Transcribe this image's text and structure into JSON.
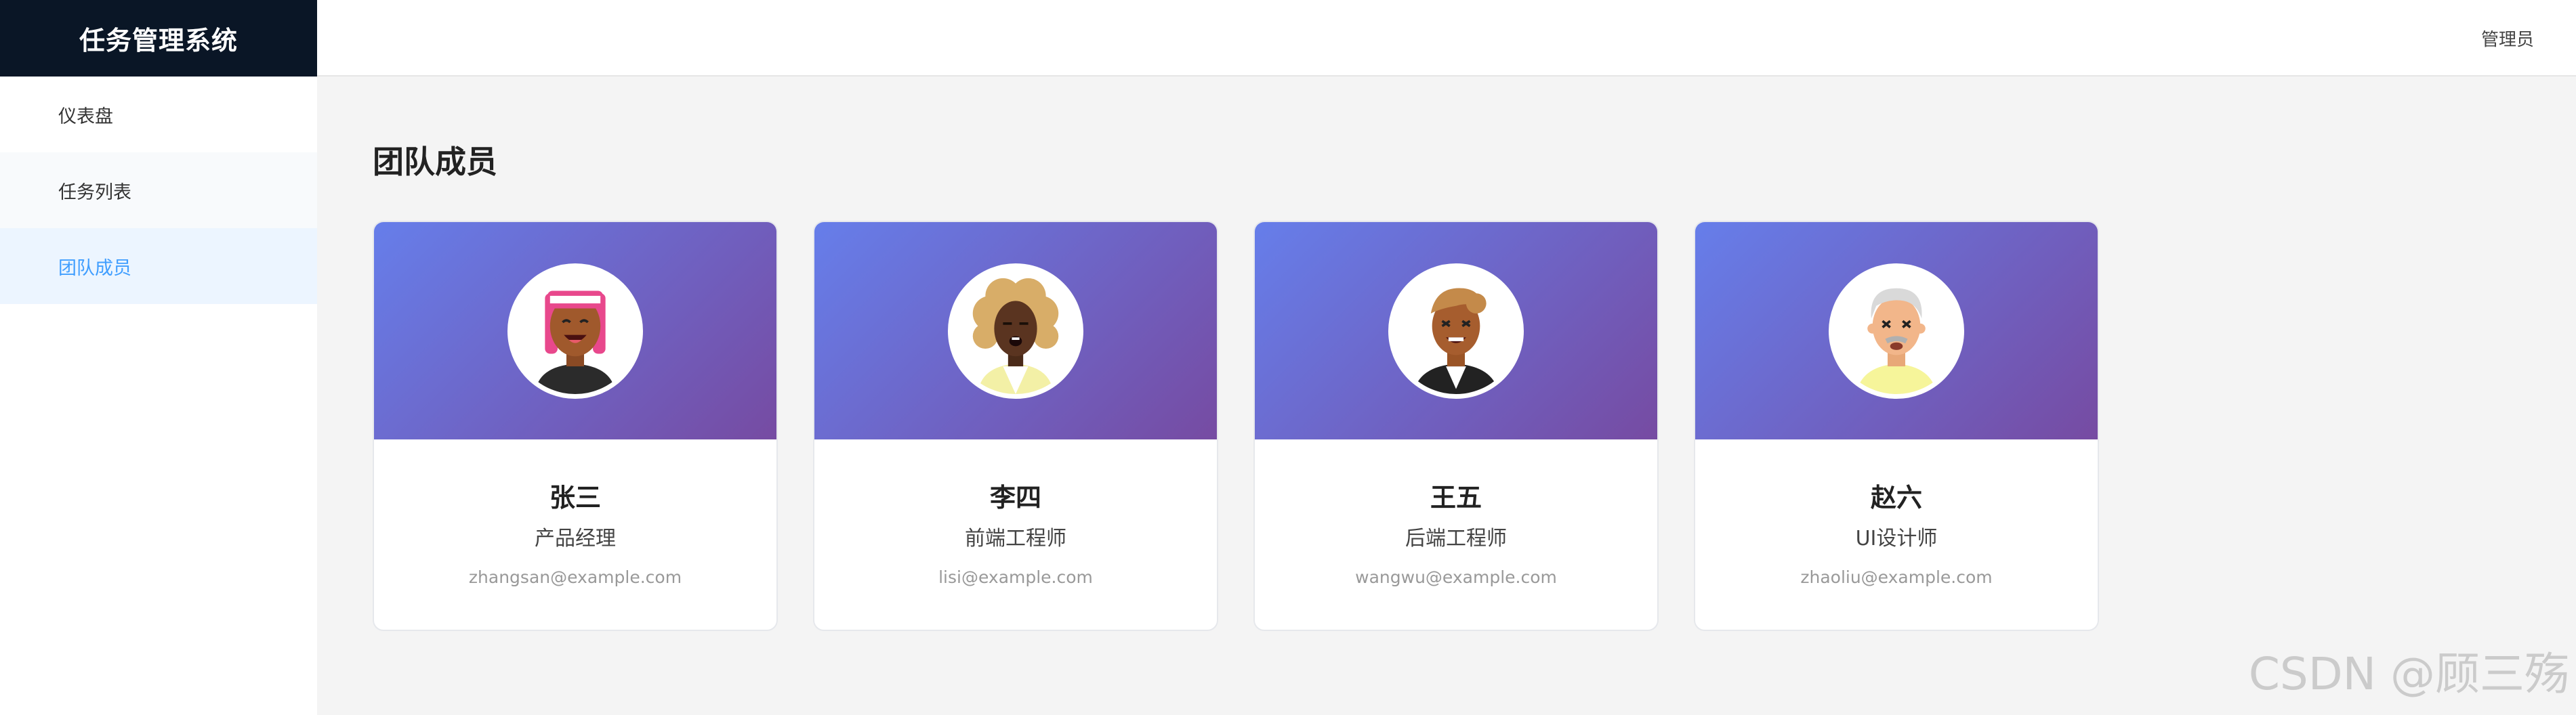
{
  "sidebar": {
    "brand": "任务管理系统",
    "items": [
      {
        "label": "仪表盘"
      },
      {
        "label": "任务列表"
      },
      {
        "label": "团队成员"
      }
    ]
  },
  "header": {
    "user": "管理员"
  },
  "main": {
    "title": "团队成员",
    "members": [
      {
        "name": "张三",
        "role": "产品经理",
        "email": "zhangsan@example.com",
        "avatar_icon": "avatar-pink-headband-icon"
      },
      {
        "name": "李四",
        "role": "前端工程师",
        "email": "lisi@example.com",
        "avatar_icon": "avatar-curly-hair-icon"
      },
      {
        "name": "王五",
        "role": "后端工程师",
        "email": "wangwu@example.com",
        "avatar_icon": "avatar-suit-icon"
      },
      {
        "name": "赵六",
        "role": "UI设计师",
        "email": "zhaoliu@example.com",
        "avatar_icon": "avatar-grey-hair-icon"
      }
    ]
  },
  "watermark": "CSDN @顾三殇",
  "colors": {
    "brand_bg": "#0a1626",
    "active_bg": "#ecf5ff",
    "active_text": "#409eff",
    "card_gradient_start": "#667eea",
    "card_gradient_end": "#764ba2"
  }
}
